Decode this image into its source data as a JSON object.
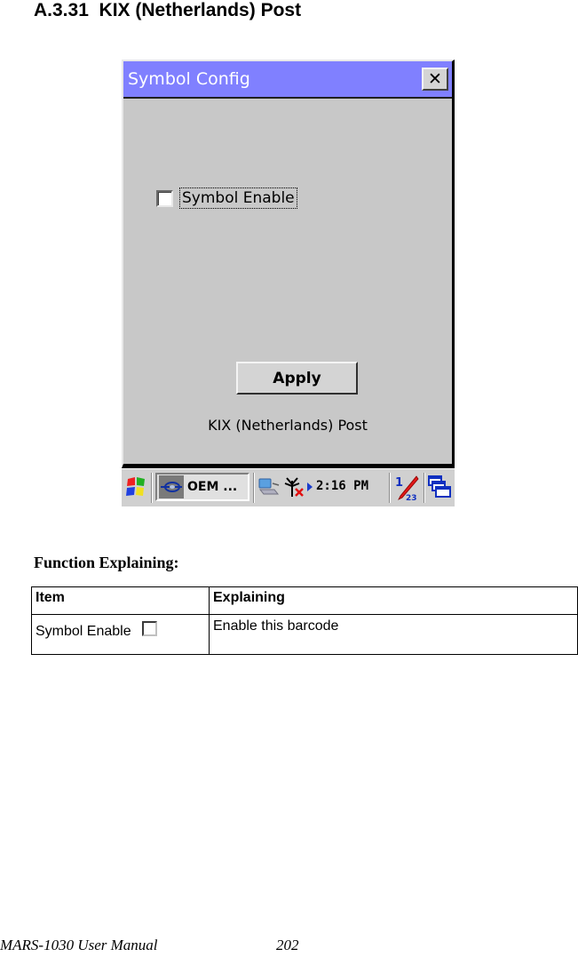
{
  "section": {
    "number": "A.3.31",
    "title": "KIX (Netherlands) Post",
    "full_title": "A.3.31  KIX (Netherlands) Post"
  },
  "screenshot": {
    "window": {
      "title": "Symbol Config",
      "close_label": "✕",
      "checkbox": {
        "label": "Symbol Enable",
        "checked": false
      },
      "apply_label": "Apply",
      "symbol_name": "KIX (Netherlands) Post"
    },
    "taskbar": {
      "start_icon": "windows-flag-icon",
      "task_button_label": "OEM ...",
      "task_icon": "oem-config-icon",
      "tray_icons": [
        "network-connection-icon",
        "antenna-disconnected-icon",
        "tray-expand-arrow-icon",
        "input-panel-icon",
        "switch-windows-icon"
      ],
      "clock": "2:16 PM"
    },
    "colors": {
      "titlebar": "#8080ff",
      "window_bg": "#c8c8c8"
    }
  },
  "function_explaining": {
    "heading": "Function Explaining:",
    "columns": [
      "Item",
      "Explaining"
    ],
    "rows": [
      {
        "item": "Symbol Enable",
        "item_icon": "checkbox-icon",
        "explaining": "Enable this barcode"
      }
    ]
  },
  "footer": {
    "manual": "MARS-1030 User Manual",
    "page": "202"
  }
}
